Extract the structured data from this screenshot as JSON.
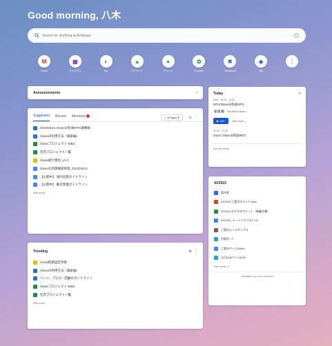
{
  "greeting": "Good morning, 八木",
  "search": {
    "placeholder": "Search for anything at Ashikaga"
  },
  "apps": [
    {
      "label": "Gmail",
      "icon": "gmail-icon",
      "glyph": "M",
      "color": "#d93025"
    },
    {
      "label": "サイボウズ",
      "icon": "cybozu-icon",
      "glyph": "▦",
      "color": "#8a3fb8"
    },
    {
      "label": "Box",
      "icon": "box-icon",
      "glyph": "◐",
      "color": "#555"
    },
    {
      "label": "Gドライブ",
      "icon": "drive-icon",
      "glyph": "▲",
      "color": "#2e9e52"
    },
    {
      "label": "チャット",
      "icon": "chat-icon",
      "glyph": "●",
      "color": "#2e9e52"
    },
    {
      "label": "Pumpkin",
      "icon": "pumpkin-icon",
      "glyph": "✿",
      "color": "#2e9e52"
    },
    {
      "label": "Confluence",
      "icon": "confluence-icon",
      "glyph": "✖",
      "color": "#2a6fd6"
    },
    {
      "label": "Jira",
      "icon": "jira-icon",
      "glyph": "◆",
      "color": "#2a6fd6"
    },
    {
      "label": "",
      "icon": "more-apps-icon",
      "glyph": "⋮",
      "color": "#888"
    }
  ],
  "announcements": {
    "title": "Announcements"
  },
  "suggested": {
    "tabs": [
      "Suggested",
      "Recent",
      "Mentions"
    ],
    "filter": "All apps",
    "items": [
      {
        "text": "2023/05/10 Glean分科会MTG議事録",
        "icon": "confluence-icon",
        "color": "#2a6fd6"
      },
      {
        "text": "Gleanの利用方法（検索編）",
        "icon": "confluence-icon",
        "color": "#2a6fd6"
      },
      {
        "text": "Gleanプロジェクト WBS",
        "icon": "sheets-icon",
        "color": "#1e8e3e"
      },
      {
        "text": "社内プロジェクト一覧",
        "icon": "sheets-icon",
        "color": "#1e8e3e"
      },
      {
        "text": "Glean紹介資料_v1.0",
        "icon": "slides-icon",
        "color": "#f4b400"
      },
      {
        "text": "Glean社内情報提供案_2023/05/10",
        "icon": "docs-icon",
        "color": "#4285f4"
      },
      {
        "text": "【公開中】 海外出張ガイドライン",
        "icon": "docs-icon",
        "color": "#4285f4"
      },
      {
        "text": "【公開中】 勤怠管理ガイドライン",
        "icon": "docs-icon",
        "color": "#4285f4"
      }
    ],
    "see_more": "See more"
  },
  "trending": {
    "title": "Trending",
    "items": [
      {
        "text": "Gmail初期設定手順",
        "icon": "slides-icon",
        "color": "#f4b400"
      },
      {
        "text": "Gleanの利用方法（検索編）",
        "icon": "confluence-icon",
        "color": "#2a6fd6"
      },
      {
        "text": "ページ、ブログ、回顧のガイドライン",
        "icon": "confluence-icon",
        "color": "#2a6fd6"
      },
      {
        "text": "Gleanプロジェクト WBS",
        "icon": "sheets-icon",
        "color": "#1e8e3e"
      },
      {
        "text": "社内プロジェクト一覧",
        "icon": "sheets-icon",
        "color": "#1e8e3e"
      }
    ],
    "see_more": "See more"
  },
  "today": {
    "title": "Today",
    "event1_time": "Now · 10:00 - 11:30",
    "event1_title": "MTG/Glean分科会MTG",
    "attendees_text": "Ken and 5 others",
    "join_label": "Join",
    "see_more": "See more",
    "event2_time": "11:00 - 12:00",
    "event2_title": "Zoom: Glean分科会MTG",
    "see_all": "See all events"
  },
  "af2023": {
    "title": "AF2023",
    "items": [
      {
        "text": "案内状",
        "icon": "docs-icon",
        "color": "#2a6fd6"
      },
      {
        "text": "AF2023 ご案内スライド.pptx",
        "icon": "pptx-icon",
        "color": "#d24726"
      },
      {
        "text": "AF2023 おすすめポイント（推薦文書）",
        "icon": "sheets-icon",
        "color": "#1e8e3e"
      },
      {
        "text": "AF2023_メーリングリスト.txt",
        "icon": "docs-icon",
        "color": "#4285f4"
      },
      {
        "text": "ご案内メールサンプル",
        "icon": "folder-icon",
        "color": "#666"
      },
      {
        "text": "京東京 - F",
        "icon": "link-icon",
        "color": "#2a9bd6"
      },
      {
        "text": "ご案内ページ(Web)",
        "icon": "docs-icon",
        "color": "#4285f4"
      },
      {
        "text": "当日込みページ(MP)",
        "icon": "link-icon",
        "color": "#2a9bd6"
      }
    ],
    "see_more": "See more",
    "managed": "Managed by your company"
  }
}
